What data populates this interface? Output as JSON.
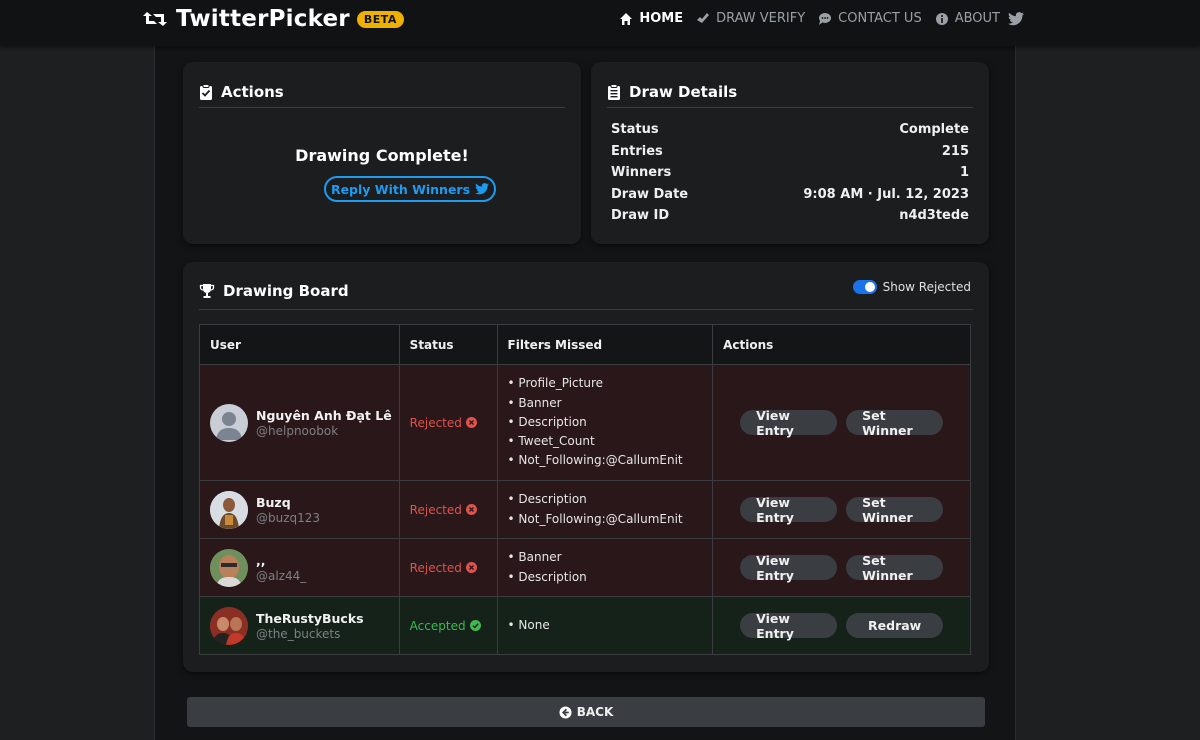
{
  "brand": {
    "name": "TwitterPicker",
    "badge": "BETA"
  },
  "nav": {
    "items": [
      {
        "label": "HOME",
        "icon": "home-icon"
      },
      {
        "label": "DRAW VERIFY",
        "icon": "check-icon"
      },
      {
        "label": "CONTACT US",
        "icon": "chat-icon"
      },
      {
        "label": "ABOUT",
        "icon": "info-icon"
      }
    ],
    "twitter_icon": "twitter-icon"
  },
  "actions": {
    "title": "Actions",
    "message": "Drawing Complete!",
    "reply_label": "Reply With Winners"
  },
  "details": {
    "title": "Draw Details",
    "rows": [
      {
        "label": "Status",
        "value": "Complete"
      },
      {
        "label": "Entries",
        "value": "215"
      },
      {
        "label": "Winners",
        "value": "1"
      },
      {
        "label": "Draw Date",
        "value": "9:08 AM · Jul. 12, 2023"
      },
      {
        "label": "Draw ID",
        "value": "n4d3tede"
      }
    ]
  },
  "board": {
    "title": "Drawing Board",
    "toggle_label": "Show Rejected",
    "columns": [
      "User",
      "Status",
      "Filters Missed",
      "Actions"
    ],
    "rows": [
      {
        "name": "Nguyên Anh Đạt Lê",
        "handle": "@helpnoobok",
        "status": "Rejected",
        "filters": [
          "Profile_Picture",
          "Banner",
          "Description",
          "Tweet_Count",
          "Not_Following:@CallumEnit"
        ],
        "view_label": "View Entry",
        "action_label": "Set Winner"
      },
      {
        "name": "Buzq",
        "handle": "@buzq123",
        "status": "Rejected",
        "filters": [
          "Description",
          "Not_Following:@CallumEnit"
        ],
        "view_label": "View Entry",
        "action_label": "Set Winner"
      },
      {
        "name": ",,",
        "handle": "@alz44_",
        "status": "Rejected",
        "filters": [
          "Banner",
          "Description"
        ],
        "view_label": "View Entry",
        "action_label": "Set Winner"
      },
      {
        "name": "TheRustyBucks",
        "handle": "@the_buckets",
        "status": "Accepted",
        "filters": [
          "None"
        ],
        "view_label": "View Entry",
        "action_label": "Redraw"
      }
    ]
  },
  "back_label": "BACK",
  "colors": {
    "accent": "#1d9bf0",
    "badge": "#f0b000",
    "rejected": "#e0524e",
    "accepted": "#3fb950"
  }
}
